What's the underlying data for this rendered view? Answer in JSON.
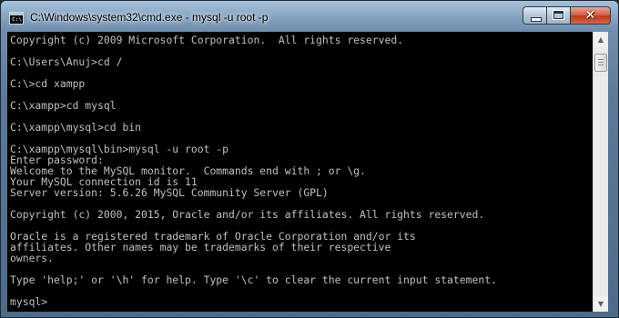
{
  "window": {
    "title": "C:\\Windows\\system32\\cmd.exe - mysql  -u root -p",
    "icon": "cmd-icon",
    "controls": {
      "minimize_icon": "minimize-icon",
      "maximize_icon": "maximize-icon",
      "close_icon": "close-icon"
    }
  },
  "console": {
    "lines": [
      "Copyright (c) 2009 Microsoft Corporation.  All rights reserved.",
      "",
      "C:\\Users\\Anuj>cd /",
      "",
      "C:\\>cd xampp",
      "",
      "C:\\xampp>cd mysql",
      "",
      "C:\\xampp\\mysql>cd bin",
      "",
      "C:\\xampp\\mysql\\bin>mysql -u root -p",
      "Enter password:",
      "Welcome to the MySQL monitor.  Commands end with ; or \\g.",
      "Your MySQL connection id is 11",
      "Server version: 5.6.26 MySQL Community Server (GPL)",
      "",
      "Copyright (c) 2000, 2015, Oracle and/or its affiliates. All rights reserved.",
      "",
      "Oracle is a registered trademark of Oracle Corporation and/or its",
      "affiliates. Other names may be trademarks of their respective",
      "owners.",
      "",
      "Type 'help;' or '\\h' for help. Type '\\c' to clear the current input statement.",
      "",
      "mysql>"
    ]
  },
  "colors": {
    "console_background": "#000000",
    "console_text": "#c0c0c0",
    "close_button": "#c0381c"
  }
}
